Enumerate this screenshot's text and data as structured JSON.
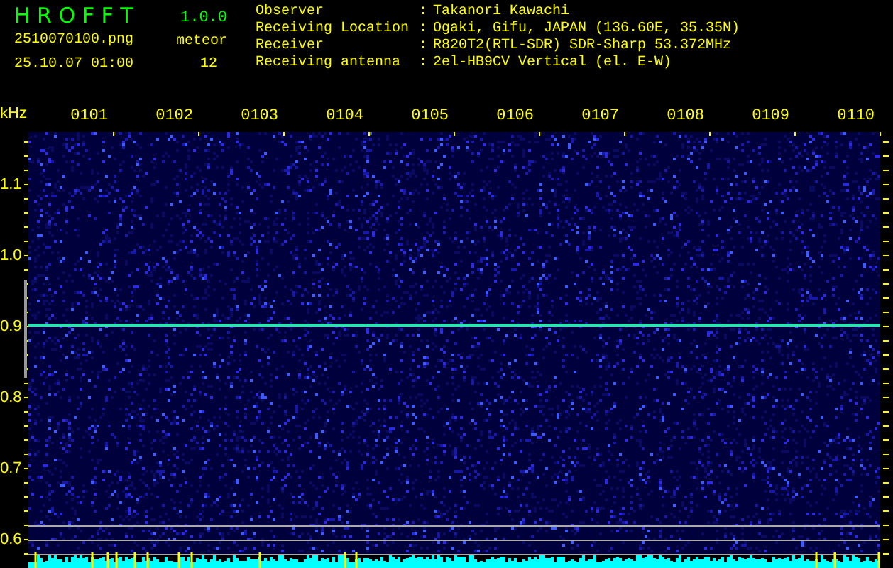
{
  "app": {
    "title": "H R O F F T",
    "version": "1.0.0"
  },
  "file": {
    "name": "2510070100.png",
    "datetime": "25.10.07 01:00"
  },
  "counter": {
    "label": "meteor",
    "value": "12"
  },
  "station": [
    {
      "label": "Observer",
      "separator": ":",
      "value": "Takanori Kawachi"
    },
    {
      "label": "Receiving Location",
      "separator": ":",
      "value": "Ogaki, Gifu, JAPAN (136.60E, 35.35N)"
    },
    {
      "label": "Receiver",
      "separator": ":",
      "value": "R820T2(RTL-SDR) SDR-Sharp 53.372MHz"
    },
    {
      "label": "Receiving antenna",
      "separator": ":",
      "value": "2el-HB9CV Vertical (el. E-W)"
    }
  ],
  "spectrogram": {
    "unit": "kHz",
    "time_labels": [
      "0101",
      "0102",
      "0103",
      "0104",
      "0105",
      "0106",
      "0107",
      "0108",
      "0109",
      "0110"
    ],
    "freq_labels": [
      "1.1",
      "1.0",
      "0.9",
      "0.8",
      "0.7",
      "0.6"
    ]
  }
}
